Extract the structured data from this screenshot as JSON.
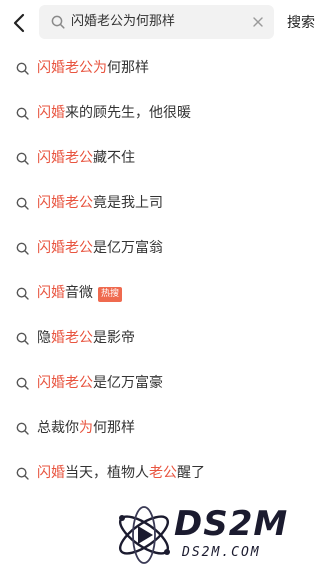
{
  "colors": {
    "highlight": "#e8543f",
    "text": "#333333",
    "search_bg": "#f2f2f2",
    "badge_bg": "#ef6a4f"
  },
  "header": {
    "back_icon": "chevron-left-icon",
    "search_icon": "search-icon",
    "query": "闪婚老公为何那样",
    "clear_icon": "close-icon",
    "search_button": "搜索"
  },
  "suggestions": [
    {
      "parts": [
        {
          "t": "闪婚老公为",
          "hl": true
        },
        {
          "t": "何那样",
          "hl": false
        }
      ]
    },
    {
      "parts": [
        {
          "t": "闪婚",
          "hl": true
        },
        {
          "t": "来的顾先生，他很暖",
          "hl": false
        }
      ]
    },
    {
      "parts": [
        {
          "t": "闪婚老公",
          "hl": true
        },
        {
          "t": "藏不住",
          "hl": false
        }
      ]
    },
    {
      "parts": [
        {
          "t": "闪婚老公",
          "hl": true
        },
        {
          "t": "竟是我上司",
          "hl": false
        }
      ]
    },
    {
      "parts": [
        {
          "t": "闪婚老公",
          "hl": true
        },
        {
          "t": "是亿万富翁",
          "hl": false
        }
      ]
    },
    {
      "parts": [
        {
          "t": "闪婚",
          "hl": true
        },
        {
          "t": "音微",
          "hl": false
        }
      ],
      "badge": "热搜"
    },
    {
      "parts": [
        {
          "t": "隐",
          "hl": false
        },
        {
          "t": "婚老公",
          "hl": true
        },
        {
          "t": "是影帝",
          "hl": false
        }
      ]
    },
    {
      "parts": [
        {
          "t": "闪婚老公",
          "hl": true
        },
        {
          "t": "是亿万富豪",
          "hl": false
        }
      ]
    },
    {
      "parts": [
        {
          "t": "总裁你",
          "hl": false
        },
        {
          "t": "为",
          "hl": true
        },
        {
          "t": "何那样",
          "hl": false
        }
      ]
    },
    {
      "parts": [
        {
          "t": "闪婚",
          "hl": true
        },
        {
          "t": "当天，植物人",
          "hl": false
        },
        {
          "t": "老公",
          "hl": true
        },
        {
          "t": "醒了",
          "hl": false
        }
      ]
    }
  ],
  "watermark": {
    "big": "DS2M",
    "small": "DS2M.COM"
  }
}
